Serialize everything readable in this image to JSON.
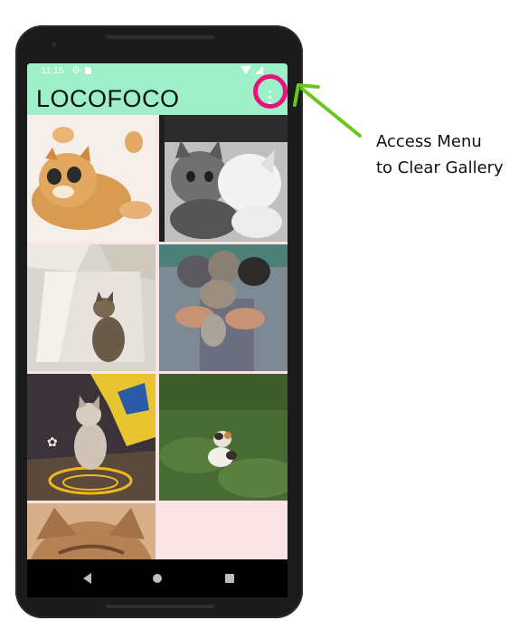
{
  "status_bar": {
    "time": "11:15"
  },
  "app": {
    "title": "LOCOFOCO",
    "menu_icon": "overflow-menu-icon"
  },
  "gallery": {
    "images": [
      {
        "subject": "orange kitten lying on back"
      },
      {
        "subject": "black and white kittens grayscale"
      },
      {
        "subject": "tabby cat in cardboard box"
      },
      {
        "subject": "hands holding three kittens"
      },
      {
        "subject": "cat sitting on blanket with yellow cable"
      },
      {
        "subject": "calico kitten on grass"
      },
      {
        "subject": "tabby cat face"
      }
    ]
  },
  "navigation": {
    "back_icon": "back-icon",
    "home_icon": "home-icon",
    "recents_icon": "recents-icon"
  },
  "annotation": {
    "line1": "Access Menu",
    "line2": "to Clear Gallery",
    "ring_color": "#e8137a",
    "arrow_color": "#6cc61e"
  },
  "colors": {
    "appbar": "#9df0c8",
    "grid_bg": "#fbe3e6"
  }
}
